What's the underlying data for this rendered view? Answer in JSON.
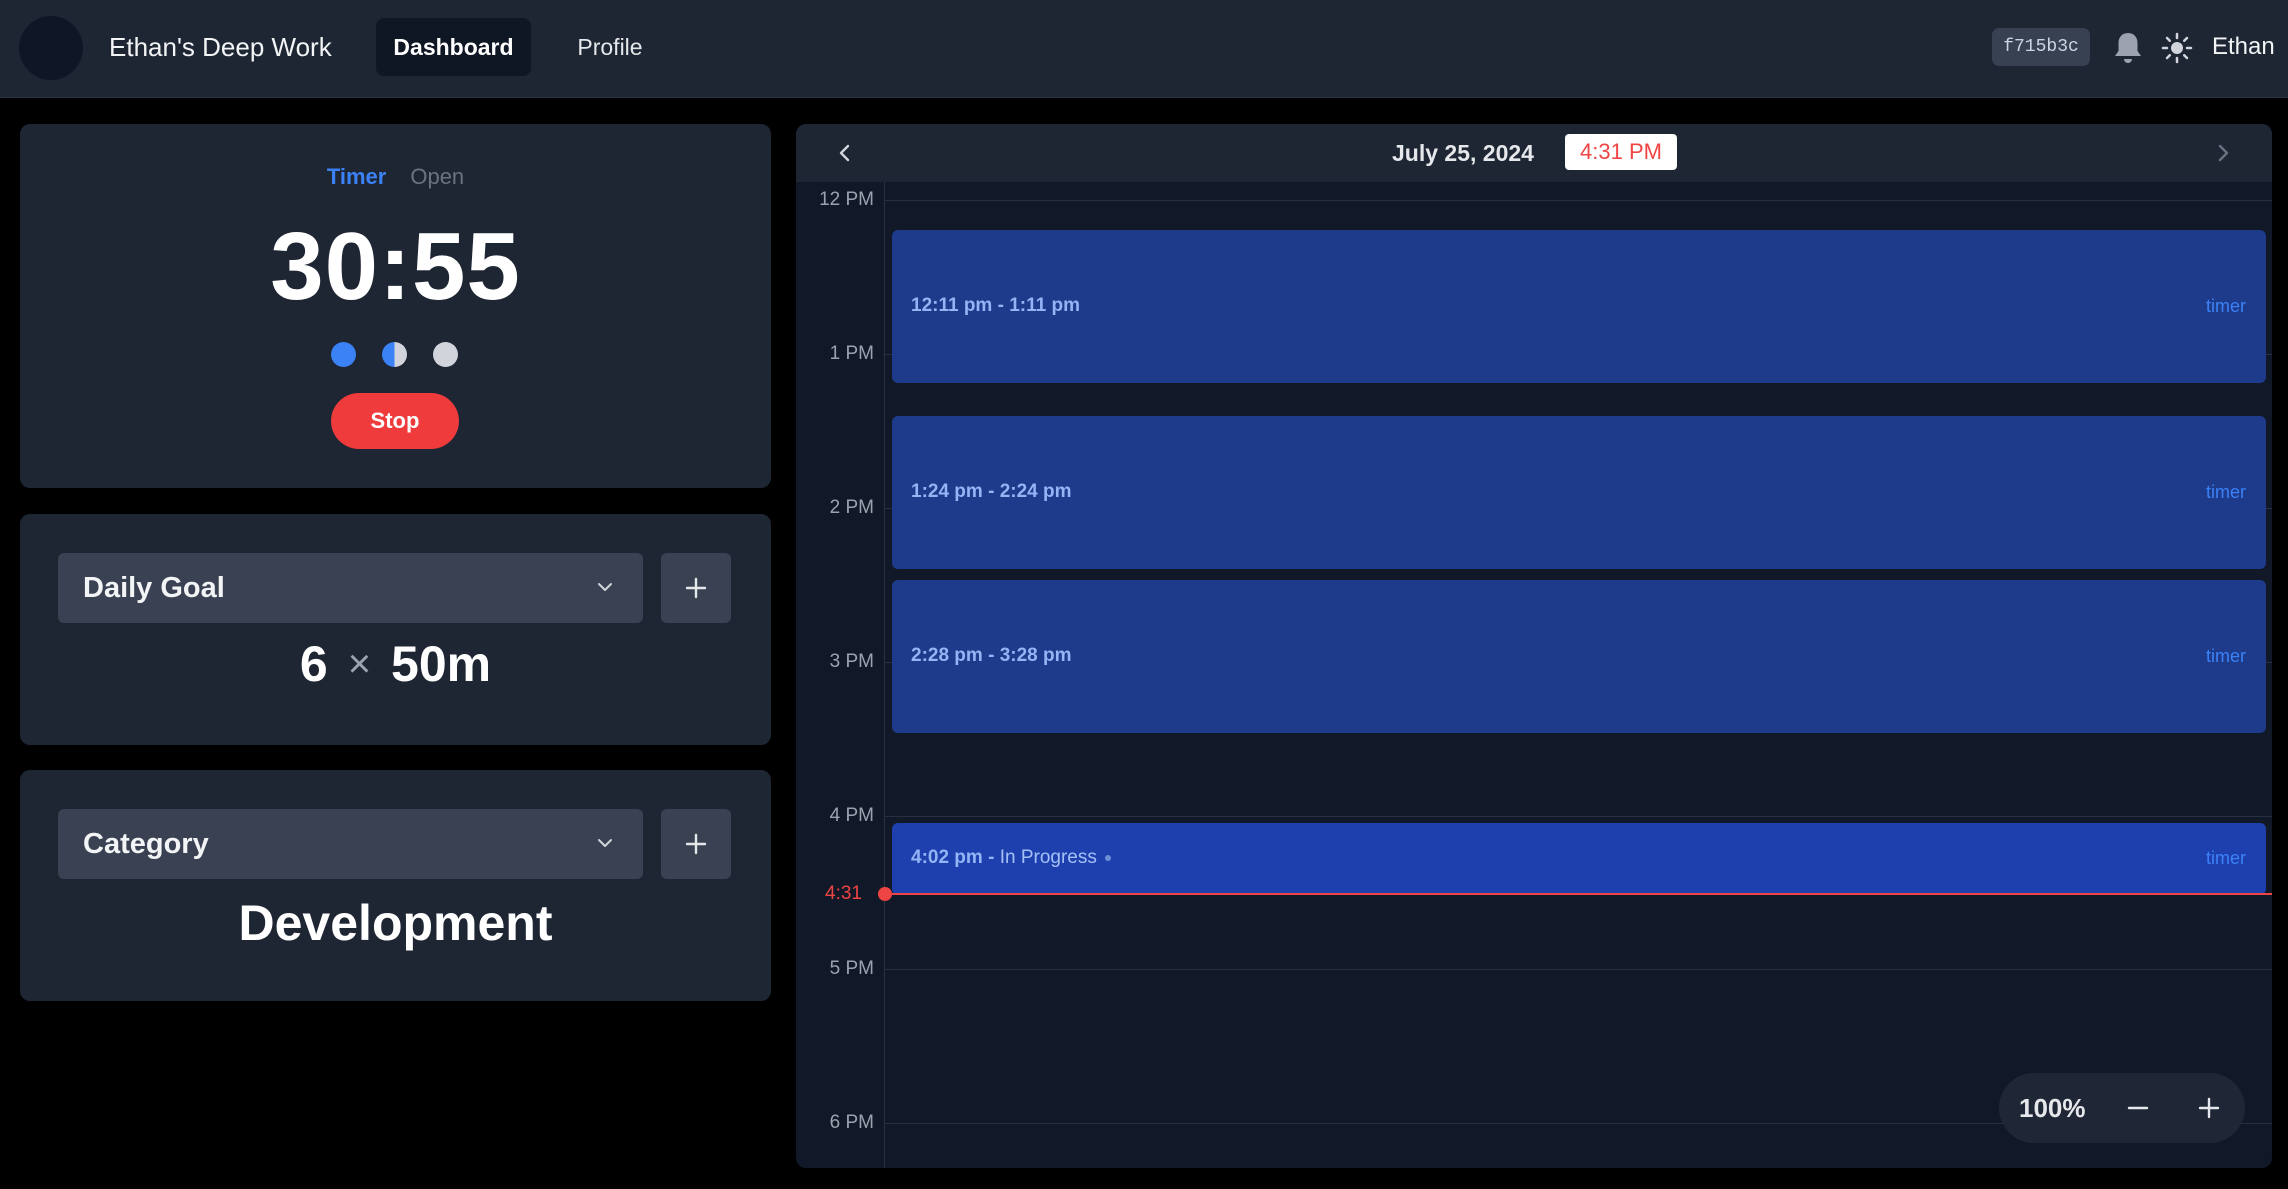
{
  "nav": {
    "title": "Ethan's Deep Work",
    "tabs": [
      {
        "label": "Dashboard",
        "active": true
      },
      {
        "label": "Profile",
        "active": false
      }
    ],
    "hash": "f715b3c",
    "username": "Ethan",
    "icons": [
      "bell-icon",
      "sun-icon"
    ]
  },
  "timer": {
    "modes": [
      "Timer",
      "Open"
    ],
    "active_mode": "Timer",
    "time": "30:55",
    "stop_label": "Stop",
    "session_dots": [
      "full",
      "half",
      "empty"
    ]
  },
  "goal": {
    "select_label": "Daily Goal",
    "count": "6",
    "times_symbol": "×",
    "duration": "50m"
  },
  "category": {
    "select_label": "Category",
    "value": "Development"
  },
  "calendar": {
    "date": "July 25, 2024",
    "now_badge": "4:31 PM",
    "now_label": "4:31",
    "hours": [
      "12 PM",
      "1 PM",
      "2 PM",
      "3 PM",
      "4 PM",
      "5 PM",
      "6 PM"
    ],
    "events": [
      {
        "time": "12:11 pm - 1:11 pm",
        "tag": "timer"
      },
      {
        "time": "1:24 pm - 2:24 pm",
        "tag": "timer"
      },
      {
        "time": "2:28 pm - 3:28 pm",
        "tag": "timer"
      },
      {
        "time": "4:02 pm - ",
        "status": "In Progress",
        "tag": "timer"
      }
    ],
    "zoom": "100%"
  },
  "colors": {
    "accent": "#3b82f6",
    "danger": "#ef4444",
    "event": "#1e3a8a",
    "event_in_progress": "#1e40af"
  }
}
